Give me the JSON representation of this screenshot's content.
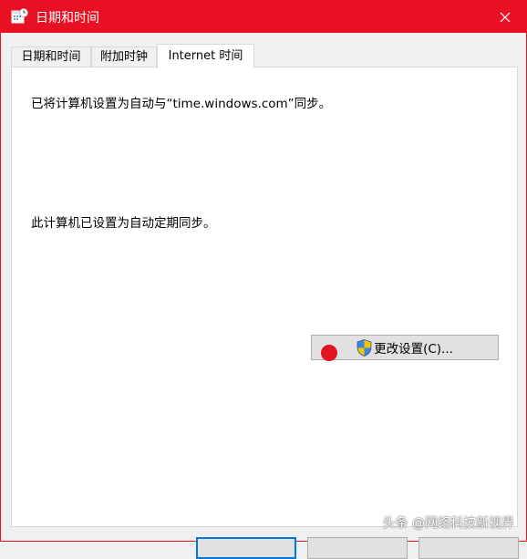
{
  "window": {
    "title": "日期和时间",
    "accent_color": "#e81123",
    "title_icon": "date-time-icon",
    "close_icon": "close-icon"
  },
  "tabs": [
    {
      "label": "日期和时间",
      "active": false
    },
    {
      "label": "附加时钟",
      "active": false
    },
    {
      "label": "Internet 时间",
      "active": true
    }
  ],
  "panel": {
    "sync_message": "已将计算机设置为自动与“time.windows.com”同步。",
    "status_message": "此计算机已设置为自动定期同步。",
    "change_button": {
      "label": "更改设置(C)...",
      "icon": "uac-shield-icon"
    }
  },
  "overlay": {
    "click_marker_color": "#e0141e",
    "watermark": "头条 @网络科技新视界"
  }
}
